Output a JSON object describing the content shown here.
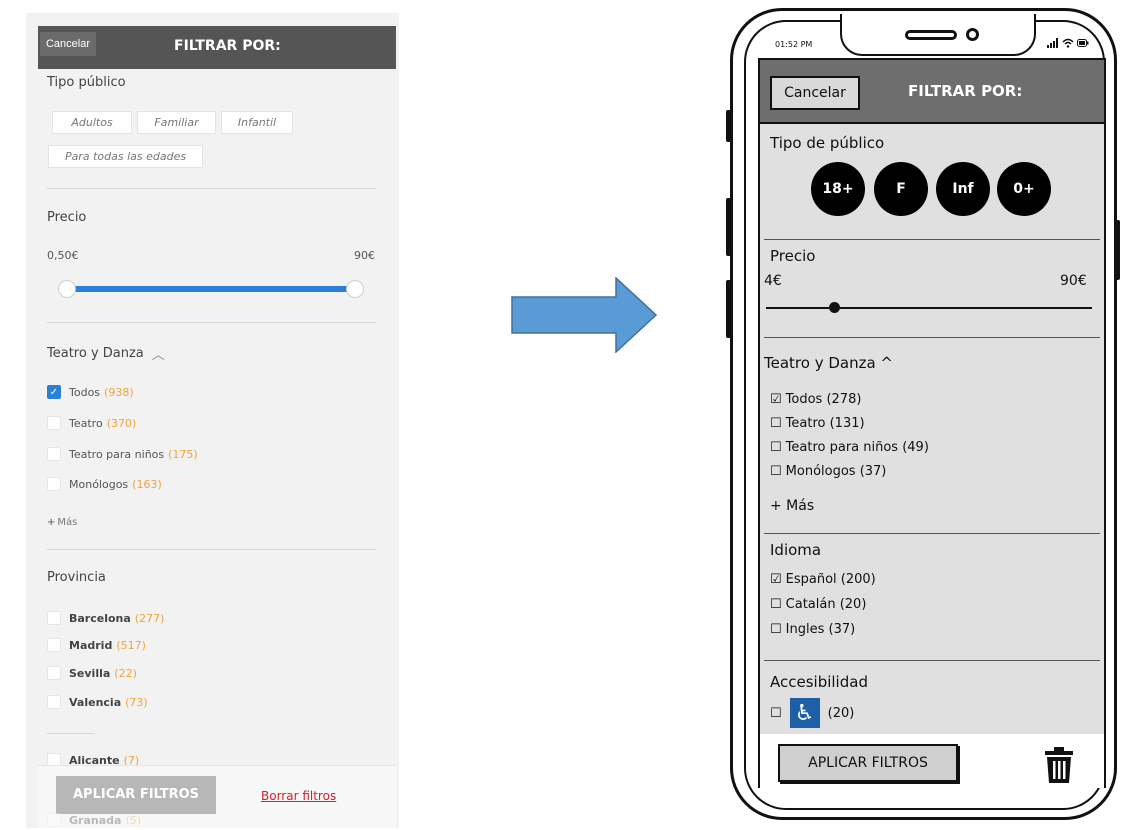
{
  "left_panel": {
    "cancel_label": "Cancelar",
    "title": "FILTRAR POR:",
    "audience": {
      "title": "Tipo público",
      "chips": [
        "Adultos",
        "Familiar",
        "Infantil",
        "Para todas las edades"
      ]
    },
    "price": {
      "title": "Precio",
      "min": "0,50€",
      "max": "90€",
      "range_fraction": [
        0.0,
        1.0
      ]
    },
    "theatre": {
      "title": "Teatro y Danza",
      "items": [
        {
          "label": "Todos",
          "count": "(938)",
          "checked": true
        },
        {
          "label": "Teatro",
          "count": "(370)",
          "checked": false
        },
        {
          "label": "Teatro para niños",
          "count": "(175)",
          "checked": false
        },
        {
          "label": "Monólogos",
          "count": "(163)",
          "checked": false
        }
      ],
      "more": "Más"
    },
    "province": {
      "title": "Provincia",
      "items": [
        {
          "label": "Barcelona",
          "count": "(277)"
        },
        {
          "label": "Madrid",
          "count": "(517)"
        },
        {
          "label": "Sevilla",
          "count": "(22)"
        },
        {
          "label": "Valencia",
          "count": "(73)"
        },
        {
          "label": "Alicante",
          "count": "(7)"
        },
        {
          "label": "Granada",
          "count": "(5)"
        }
      ]
    },
    "apply_label": "APLICAR FILTROS",
    "clear_label": "Borrar filtros"
  },
  "mockup": {
    "status_time": "01:52 PM",
    "cancel_label": "Cancelar",
    "title": "FILTRAR POR:",
    "audience": {
      "title": "Tipo de público",
      "circles": [
        "18+",
        "F",
        "Inf",
        "0+"
      ]
    },
    "price": {
      "title": "Precio",
      "min": "4€",
      "max": "90€",
      "slider_fraction": 0.22
    },
    "theatre": {
      "title": "Teatro y Danza ^",
      "items": [
        {
          "label": "Todos (278)",
          "checked": true
        },
        {
          "label": "Teatro (131)",
          "checked": false
        },
        {
          "label": "Teatro para niños (49)",
          "checked": false
        },
        {
          "label": "Monólogos (37)",
          "checked": false
        }
      ],
      "more": "+ Más"
    },
    "language": {
      "title": "Idioma",
      "items": [
        {
          "label": "Español (200)",
          "checked": true
        },
        {
          "label": "Catalán (20)",
          "checked": false
        },
        {
          "label": "Ingles (37)",
          "checked": false
        }
      ]
    },
    "accessibility": {
      "title": "Accesibilidad",
      "count": "(20)",
      "icon": "wheelchair-icon"
    },
    "apply_label": "APLICAR FILTROS",
    "trash_icon": "trash-icon"
  },
  "colors": {
    "accent_blue": "#2b7fd8",
    "count_orange": "#f2a33a",
    "link_red": "#d4202a",
    "arrow_blue": "#5b9bd5"
  }
}
